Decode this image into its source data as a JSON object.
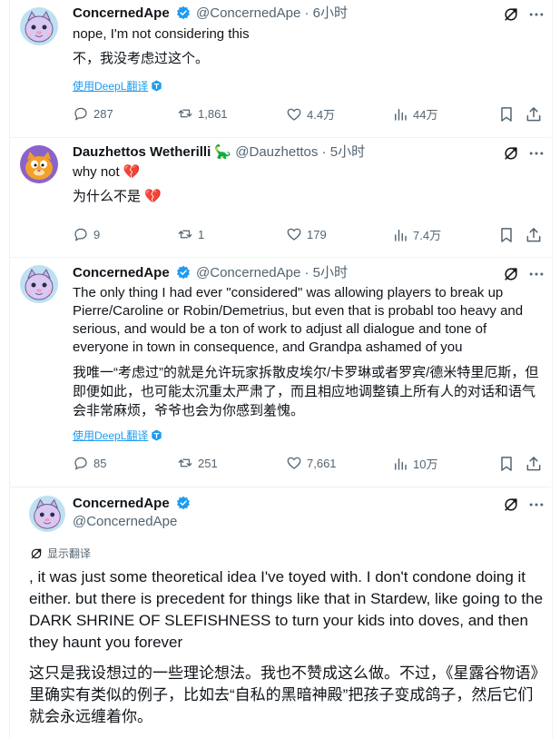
{
  "tweets": [
    {
      "name": "ConcernedApe",
      "handle": "@ConcernedApe",
      "time": "· 6小时",
      "text": "nope, I'm not considering this",
      "translation": "不，我没考虑过这个。",
      "translate_link": "使用DeepL翻译",
      "replies": "287",
      "retweets": "1,861",
      "likes": "4.4万",
      "views": "44万"
    },
    {
      "name": "Dauzhettos Wetherilli",
      "name_emoji": "🦕",
      "handle": "@Dauzhettos",
      "time": "· 5小时",
      "text": "why not 💔",
      "translation": "为什么不是 💔",
      "replies": "9",
      "retweets": "1",
      "likes": "179",
      "views": "7.4万"
    },
    {
      "name": "ConcernedApe",
      "handle": "@ConcernedApe",
      "time": "· 5小时",
      "text": "The only thing I had ever \"considered\" was allowing players to break up Pierre/Caroline or Robin/Demetrius, but even that is probabl too heavy and serious, and would be a ton of work to adjust all dialogue and tone  of everyone in town in consequence, and Grandpa ashamed of you",
      "translation": "我唯一“考虑过”的就是允许玩家拆散皮埃尔/卡罗琳或者罗宾/德米特里厄斯，但即便如此，也可能太沉重太严肃了，而且相应地调整镇上所有人的对话和语气会非常麻烦，爷爷也会为你感到羞愧。",
      "translate_link": "使用DeepL翻译",
      "replies": "85",
      "retweets": "251",
      "likes": "7,661",
      "views": "10万"
    }
  ],
  "main_tweet": {
    "name": "ConcernedApe",
    "handle": "@ConcernedApe",
    "show_translation": "显示翻译",
    "text": ", it was just some theoretical idea I've toyed with. I don't condone doing it either. but there is precedent for things like that in Stardew, like going to the DARK SHRINE OF SLEFISHNESS to turn your kids into doves, and then they haunt you forever",
    "translation": "这只是我设想过的一些理论想法。我也不赞成这么做。不过，《星露谷物语》里确实有类似的例子，比如去“自私的黑暗神殿”把孩子变成鸽子，然后它们就会永远缠着你。"
  },
  "colors": {
    "accent": "#1d9bf0",
    "muted": "#536471",
    "text": "#0f1419",
    "divider": "#eff3f4"
  }
}
